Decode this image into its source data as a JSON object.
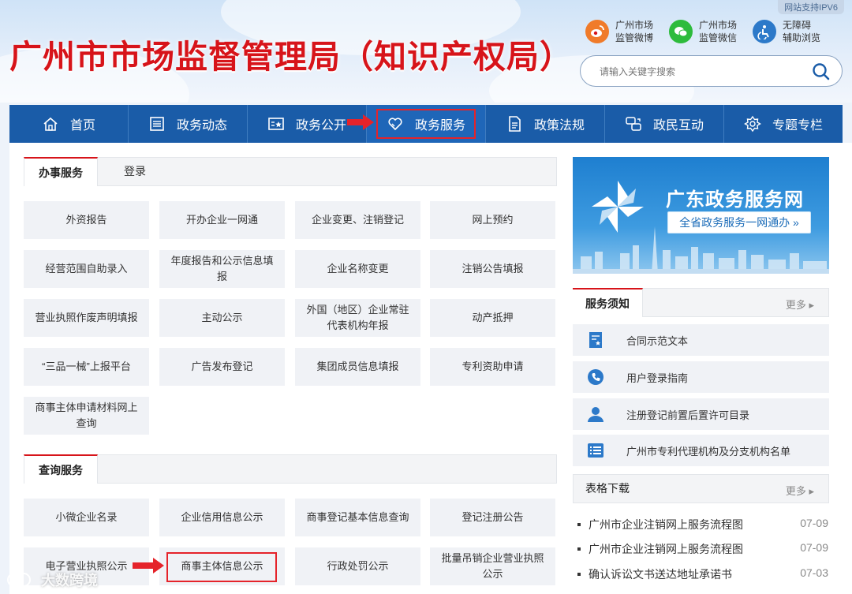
{
  "header": {
    "title": "广州市市场监督管理局（知识产权局）",
    "ipv6": "网站支持IPV6",
    "quick_links": [
      {
        "label_line1": "广州市场",
        "label_line2": "监管微博",
        "icon": "weibo-icon",
        "color": "#f07b2a"
      },
      {
        "label_line1": "广州市场",
        "label_line2": "监管微信",
        "icon": "wechat-icon",
        "color": "#2dbb3c"
      },
      {
        "label_line1": "无障碍",
        "label_line2": "辅助浏览",
        "icon": "accessibility-icon",
        "color": "#2c79c9"
      }
    ],
    "search_placeholder": "请输入关键字搜索"
  },
  "nav": [
    {
      "label": "首页",
      "icon": "home-icon"
    },
    {
      "label": "政务动态",
      "icon": "news-icon"
    },
    {
      "label": "政务公开",
      "icon": "public-info-icon"
    },
    {
      "label": "政务服务",
      "icon": "heart-icon",
      "active": true
    },
    {
      "label": "政策法规",
      "icon": "document-icon"
    },
    {
      "label": "政民互动",
      "icon": "interaction-icon"
    },
    {
      "label": "专题专栏",
      "icon": "special-icon"
    }
  ],
  "left": {
    "tab_active": "办事服务",
    "tab_login": "登录",
    "services": [
      "外资报告",
      "开办企业一网通",
      "企业变更、注销登记",
      "网上预约",
      "经营范围自助录入",
      "年度报告和公示信息填报",
      "企业名称变更",
      "注销公告填报",
      "营业执照作废声明填报",
      "主动公示",
      "外国（地区）企业常驻代表机构年报",
      "动产抵押",
      "“三品一械”上报平台",
      "广告发布登记",
      "集团成员信息填报",
      "专利资助申请",
      "商事主体申请材料网上查询"
    ],
    "query_title": "查询服务",
    "queries": [
      "小微企业名录",
      "企业信用信息公示",
      "商事登记基本信息查询",
      "登记注册公告",
      "电子营业执照公示",
      "商事主体信息公示",
      "行政处罚公示",
      "批量吊销企业营业执照公示"
    ]
  },
  "right": {
    "banner_title": "广东政务服务网",
    "banner_sub": "全省政务服务一网通办 »",
    "notice_title": "服务须知",
    "more": "更多",
    "notices": [
      {
        "label": "合同示范文本",
        "icon": "contract-icon"
      },
      {
        "label": "用户登录指南",
        "icon": "phone-icon"
      },
      {
        "label": "注册登记前置后置许可目录",
        "icon": "user-icon"
      },
      {
        "label": "广州市专利代理机构及分支机构名单",
        "icon": "list-icon"
      }
    ],
    "download_title": "表格下载",
    "downloads": [
      {
        "label": "广州市企业注销网上服务流程图",
        "date": "07-09"
      },
      {
        "label": "广州市企业注销网上服务流程图",
        "date": "07-09"
      },
      {
        "label": "确认诉讼文书送达地址承诺书",
        "date": "07-03"
      }
    ]
  },
  "watermark": "大数跨境"
}
